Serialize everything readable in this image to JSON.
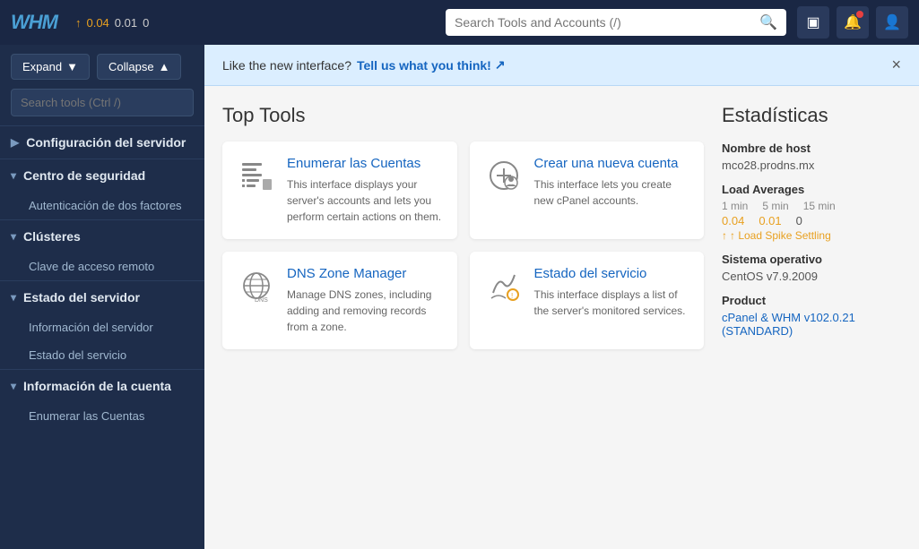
{
  "topbar": {
    "logo_text": "WHM",
    "load_label": "0.04",
    "load_label2": "0.01",
    "load_label3": "0",
    "search_placeholder": "Search Tools and Accounts (/)"
  },
  "icons": {
    "monitor": "▣",
    "bell": "🔔",
    "user": "👤",
    "search": "🔍",
    "expand_arrow": "▼",
    "collapse_arrow": "▲",
    "chevron_down": "▾",
    "external_link": "↗"
  },
  "sidebar": {
    "expand_label": "Expand",
    "collapse_label": "Collapse",
    "search_placeholder": "Search tools (Ctrl /)",
    "sections": [
      {
        "title": "Configuración del servidor",
        "expanded": false,
        "items": []
      },
      {
        "title": "Centro de seguridad",
        "expanded": true,
        "items": [
          "Autenticación de dos factores"
        ]
      },
      {
        "title": "Clústeres",
        "expanded": true,
        "items": [
          "Clave de acceso remoto"
        ]
      },
      {
        "title": "Estado del servidor",
        "expanded": true,
        "items": [
          "Información del servidor",
          "Estado del servicio"
        ]
      },
      {
        "title": "Información de la cuenta",
        "expanded": true,
        "items": [
          "Enumerar las Cuentas"
        ]
      }
    ]
  },
  "banner": {
    "text": "Like the new interface?",
    "link_text": "Tell us what you think!",
    "close_label": "×"
  },
  "main": {
    "title": "Top Tools",
    "tools": [
      {
        "id": "enumerate",
        "title": "Enumerar las Cuentas",
        "description": "This interface displays your server's accounts and lets you perform certain actions on them."
      },
      {
        "id": "create-account",
        "title": "Crear una nueva cuenta",
        "description": "This interface lets you create new cPanel accounts."
      },
      {
        "id": "dns-zone",
        "title": "DNS Zone Manager",
        "description": "Manage DNS zones, including adding and removing records from a zone."
      },
      {
        "id": "service-status",
        "title": "Estado del servicio",
        "description": "This interface displays a list of the server's monitored services."
      }
    ]
  },
  "stats": {
    "title": "Estadísticas",
    "hostname_label": "Nombre de host",
    "hostname_value": "mco28.prodns.mx",
    "load_avg_label": "Load Averages",
    "load_headers": [
      "1 min",
      "5 min",
      "15 min"
    ],
    "load_values": [
      "0.04",
      "0.01",
      "0"
    ],
    "load_spike_text": "↑ Load Spike Settling",
    "os_label": "Sistema operativo",
    "os_value": "CentOS v7.9.2009",
    "product_label": "Product",
    "product_value": "cPanel & WHM v102.0.21 (STANDARD)"
  }
}
